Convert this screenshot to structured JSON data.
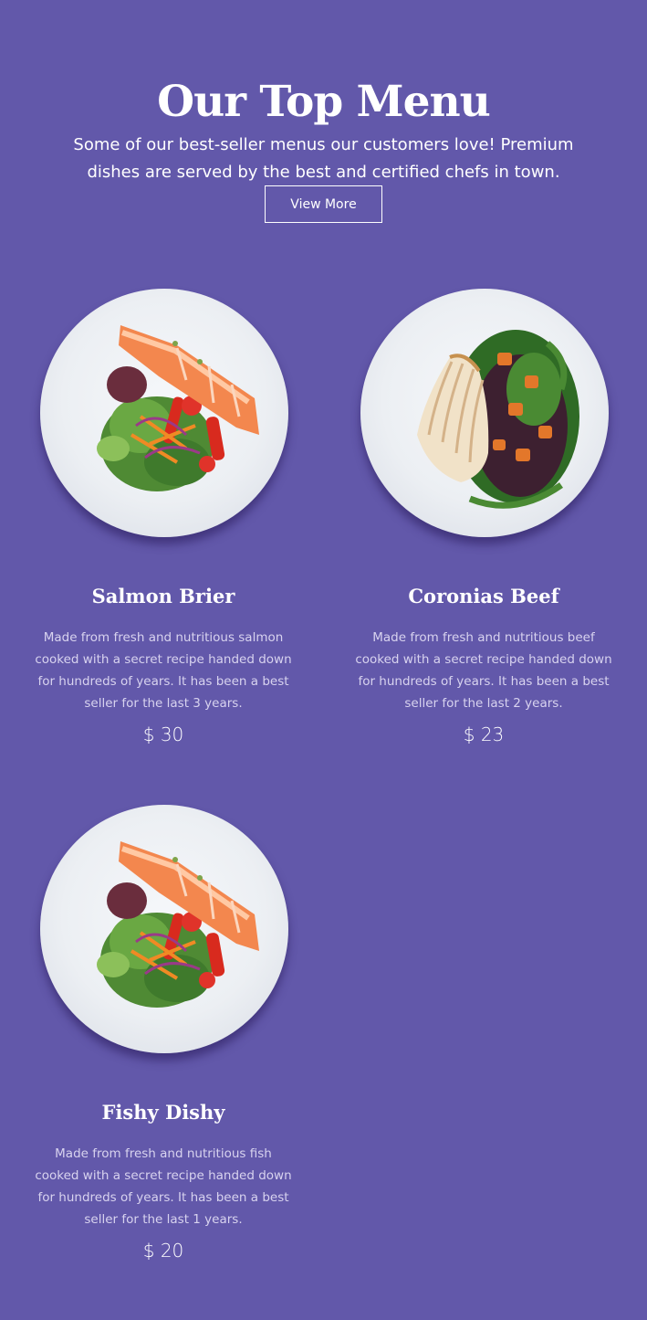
{
  "header": {
    "title": "Our Top Menu",
    "subtitle": "Some of our best-seller menus our customers love! Premium dishes are served by the best and certified chefs in town.",
    "view_more_label": "View More"
  },
  "colors": {
    "background": "#6258aa",
    "text": "#ffffff",
    "muted_text": "#d8d3ef"
  },
  "menu": {
    "items": [
      {
        "name": "Salmon Brier",
        "description": "Made from fresh and nutritious salmon cooked with a secret recipe handed down for hundreds of years. It has been a best seller for the last 3 years.",
        "price": "$ 30",
        "image": "salmon-salad-plate"
      },
      {
        "name": "Coronias Beef",
        "description": "Made from fresh and nutritious beef cooked with a secret recipe handed down for hundreds of years. It has been a best seller for the last 2 years.",
        "price": "$ 23",
        "image": "sliced-meat-quinoa-plate"
      },
      {
        "name": "Fishy Dishy",
        "description": "Made from fresh and nutritious fish cooked with a secret recipe handed down for hundreds of years. It has been a best seller for the last 1 years.",
        "price": "$ 20",
        "image": "salmon-salad-plate"
      }
    ]
  }
}
